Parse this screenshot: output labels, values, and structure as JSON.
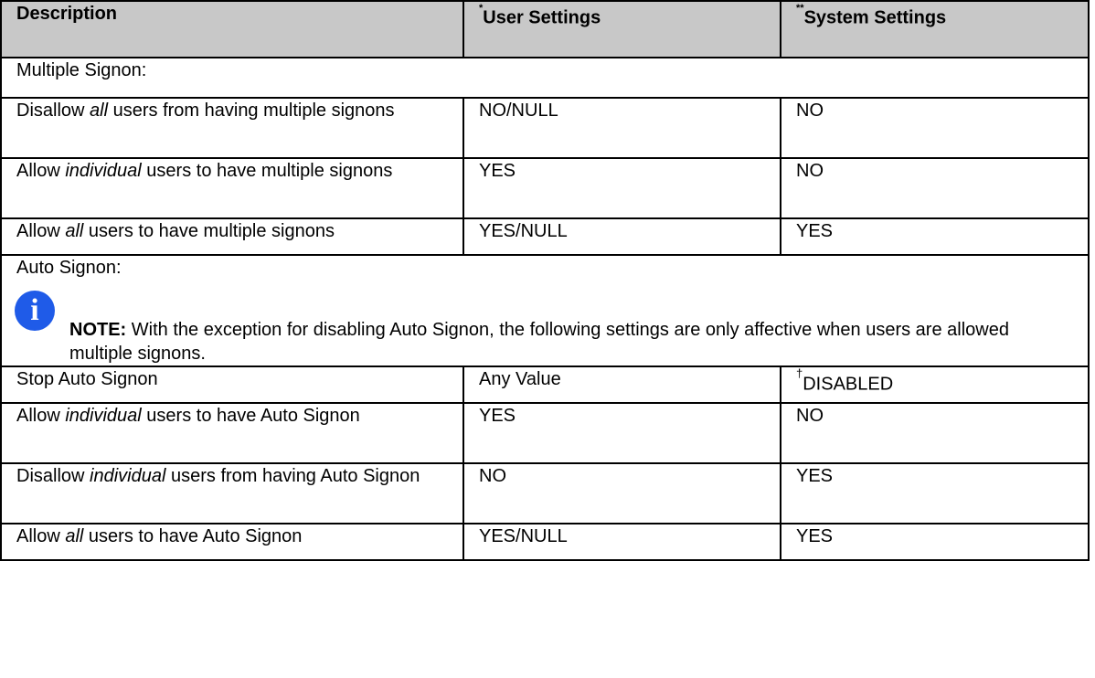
{
  "table": {
    "headers": {
      "description": "Description",
      "user_settings": "User Settings",
      "user_mark": "*",
      "system_settings": "System Settings",
      "system_mark": "**"
    },
    "sections": {
      "multiple_signon": "Multiple Signon:",
      "auto_signon": "Auto Signon:"
    },
    "rows_multiple": [
      {
        "pre": "Disallow ",
        "em": "all",
        "post": " users from having multiple signons",
        "user": "NO/NULL",
        "system": "NO"
      },
      {
        "pre": "Allow ",
        "em": "individual",
        "post": " users to have multiple signons",
        "user": "YES",
        "system": "NO"
      },
      {
        "pre": "Allow ",
        "em": "all",
        "post": " users to have multiple signons",
        "user": "YES/NULL",
        "system": "YES"
      }
    ],
    "note": {
      "label": "NOTE:",
      "text": " With the exception for disabling Auto Signon, the following settings are only affective when users are allowed multiple signons.",
      "icon": "info-icon"
    },
    "rows_auto": [
      {
        "pre": "Stop Auto Signon",
        "em": "",
        "post": "",
        "user": "Any Value",
        "system_mark": "†",
        "system": "DISABLED"
      },
      {
        "pre": "Allow ",
        "em": "individual",
        "post": " users to have Auto Signon",
        "user": "YES",
        "system_mark": "",
        "system": "NO"
      },
      {
        "pre": "Disallow ",
        "em": "individual",
        "post": " users from having Auto Signon",
        "user": "NO",
        "system_mark": "",
        "system": "YES"
      },
      {
        "pre": "Allow ",
        "em": "all",
        "post": " users to have Auto Signon",
        "user": "YES/NULL",
        "system_mark": "",
        "system": "YES"
      }
    ]
  }
}
